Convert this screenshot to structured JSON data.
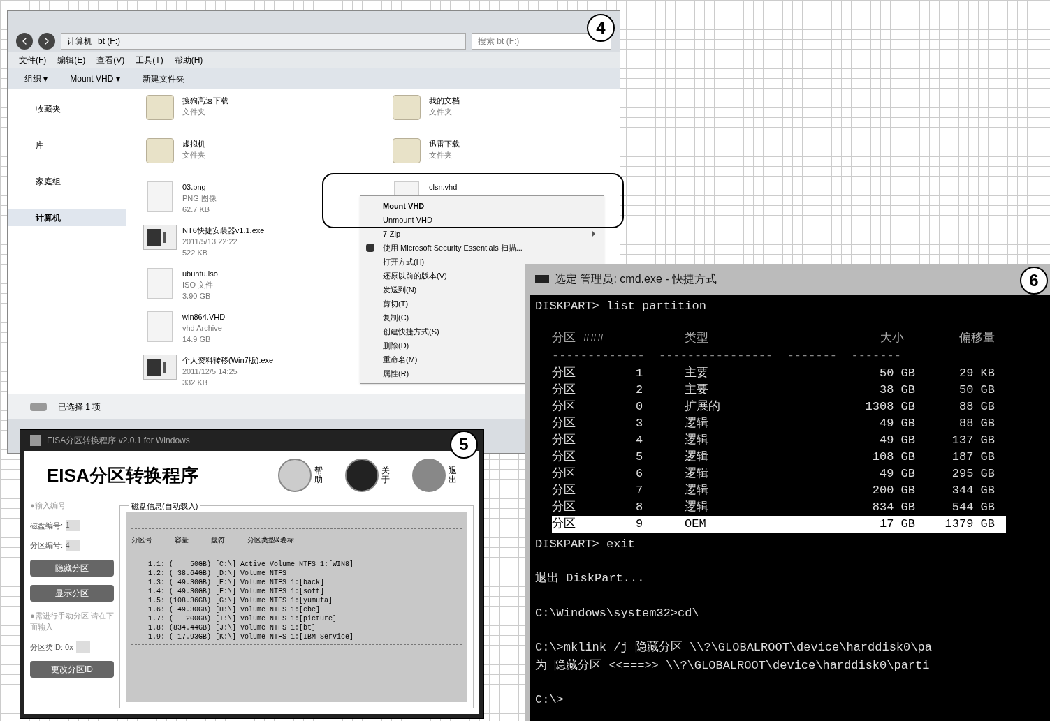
{
  "callouts": [
    "4",
    "5",
    "6"
  ],
  "explorer": {
    "address": [
      "计算机",
      "bt (F:)"
    ],
    "search": {
      "placeholder": "搜索 bt (F:)"
    },
    "menu": [
      "文件(F)",
      "编辑(E)",
      "查看(V)",
      "工具(T)",
      "帮助(H)"
    ],
    "toolbar": [
      "组织 ▾",
      "Mount VHD ▾",
      "新建文件夹"
    ],
    "sidebar": [
      {
        "label": "收藏夹",
        "selected": false
      },
      {
        "label": "库",
        "selected": false
      },
      {
        "label": "家庭组",
        "selected": false
      },
      {
        "label": "计算机",
        "selected": true
      }
    ],
    "files": [
      {
        "kind": "folder",
        "name": "搜狗高速下载",
        "lines": [
          "文件夹"
        ]
      },
      {
        "kind": "folder",
        "name": "我的文档",
        "lines": [
          "文件夹"
        ]
      },
      {
        "kind": "folder",
        "name": "虚拟机",
        "lines": [
          "文件夹"
        ]
      },
      {
        "kind": "folder",
        "name": "迅雷下载",
        "lines": [
          "文件夹"
        ]
      },
      {
        "kind": "doc",
        "name": "03.png",
        "lines": [
          "PNG 图像",
          "62.7 KB"
        ]
      },
      {
        "kind": "doc",
        "name": "clsn.vhd"
      },
      {
        "kind": "exe",
        "name": "NT6快捷安装器v1.1.exe",
        "lines": [
          "2011/5/13 22:22",
          "522 KB"
        ]
      },
      {
        "kind": "none"
      },
      {
        "kind": "doc",
        "name": "ubuntu.iso",
        "lines": [
          "ISO 文件",
          "3.90 GB"
        ]
      },
      {
        "kind": "none"
      },
      {
        "kind": "doc",
        "name": "win864.VHD",
        "lines": [
          "vhd Archive",
          "14.9 GB"
        ]
      },
      {
        "kind": "none"
      },
      {
        "kind": "exe",
        "name": "个人资料转移(Win7版).exe",
        "lines": [
          "2011/12/5 14:25",
          "332 KB"
        ]
      }
    ],
    "status": "已选择 1 项",
    "context_menu": [
      {
        "label": "Mount VHD",
        "bold": true
      },
      {
        "label": "Unmount VHD",
        "bold": false
      },
      {
        "label": "7-Zip",
        "bold": false,
        "submenu": true
      },
      {
        "label": "使用 Microsoft Security Essentials 扫描...",
        "bold": false,
        "icon": true
      },
      {
        "label": "打开方式(H)",
        "bold": false
      },
      {
        "label": "还原以前的版本(V)",
        "bold": false
      },
      {
        "label": "发送到(N)",
        "bold": false
      },
      {
        "label": "剪切(T)",
        "bold": false
      },
      {
        "label": "复制(C)",
        "bold": false
      },
      {
        "label": "创建快捷方式(S)",
        "bold": false
      },
      {
        "label": "删除(D)",
        "bold": false
      },
      {
        "label": "重命名(M)",
        "bold": false
      },
      {
        "label": "属性(R)",
        "bold": false
      }
    ]
  },
  "eisa": {
    "title": "EISA分区转换程序 v2.0.1 for Windows",
    "heading": "EISA分区转换程序",
    "actions": [
      {
        "label": "帮助",
        "kind": "help"
      },
      {
        "label": "关于",
        "kind": "about"
      },
      {
        "label": "退出",
        "kind": "exit"
      }
    ],
    "left": [
      {
        "kind": "note",
        "text": "●输入编号"
      },
      {
        "kind": "field",
        "label": "磁盘编号:",
        "value": "1"
      },
      {
        "kind": "field",
        "label": "分区编号:",
        "value": "4"
      },
      {
        "kind": "button",
        "text": "隐藏分区"
      },
      {
        "kind": "button",
        "text": "显示分区"
      },
      {
        "kind": "note",
        "text": "●需进行手动分区 请在下面输入"
      },
      {
        "kind": "field",
        "label": "分区类ID: 0x"
      },
      {
        "kind": "button",
        "text": "更改分区ID"
      }
    ],
    "group": "磁盘信息(自动载入)",
    "listing_header": [
      "分区号",
      "容量",
      "盘符",
      "分区类型&卷标"
    ],
    "listing": [
      "1.1: (    50GB) [C:\\] Active Volume NTFS 1:[WIN8]",
      "1.2: ( 38.64GB) [D:\\] Volume NTFS",
      "1.3: ( 49.30GB) [E:\\] Volume NTFS 1:[back]",
      "1.4: ( 49.30GB) [F:\\] Volume NTFS 1:[soft]",
      "1.5: (108.36GB) [G:\\] Volume NTFS 1:[yumufa]",
      "1.6: ( 49.30GB) [H:\\] Volume NTFS 1:[cbe]",
      "1.7: (   200GB) [I:\\] Volume NTFS 1:[picture]",
      "1.8: (834.44GB) [J:\\] Volume NTFS 1:[bt]",
      "1.9: ( 17.93GB) [K:\\] Volume NTFS 1:[IBM_Service]"
    ]
  },
  "cmd": {
    "title": "选定 管理员: cmd.exe - 快捷方式",
    "command1": "DISKPART> list partition",
    "columns": [
      "分区 ###",
      "类型",
      "大小",
      "偏移量"
    ],
    "separator": "-------------  ----------------  -------  -------",
    "rows": [
      {
        "name": "分区",
        "num": "1",
        "type": "主要",
        "size": "50 GB",
        "offset": "29 KB",
        "selected": false
      },
      {
        "name": "分区",
        "num": "2",
        "type": "主要",
        "size": "38 GB",
        "offset": "50 GB",
        "selected": false
      },
      {
        "name": "分区",
        "num": "0",
        "type": "扩展的",
        "size": "1308 GB",
        "offset": "88 GB",
        "selected": false
      },
      {
        "name": "分区",
        "num": "3",
        "type": "逻辑",
        "size": "49 GB",
        "offset": "88 GB",
        "selected": false
      },
      {
        "name": "分区",
        "num": "4",
        "type": "逻辑",
        "size": "49 GB",
        "offset": "137 GB",
        "selected": false
      },
      {
        "name": "分区",
        "num": "5",
        "type": "逻辑",
        "size": "108 GB",
        "offset": "187 GB",
        "selected": false
      },
      {
        "name": "分区",
        "num": "6",
        "type": "逻辑",
        "size": "49 GB",
        "offset": "295 GB",
        "selected": false
      },
      {
        "name": "分区",
        "num": "7",
        "type": "逻辑",
        "size": "200 GB",
        "offset": "344 GB",
        "selected": false
      },
      {
        "name": "分区",
        "num": "8",
        "type": "逻辑",
        "size": "834 GB",
        "offset": "544 GB",
        "selected": false
      },
      {
        "name": "分区",
        "num": "9",
        "type": "OEM",
        "size": "17 GB",
        "offset": "1379 GB",
        "selected": true
      }
    ],
    "after": [
      [
        "DISKPART> exit"
      ],
      [
        "退出 DiskPart..."
      ],
      [
        "C:\\Windows\\system32>cd\\"
      ],
      [
        "C:\\>mklink /j 隐藏分区 \\\\?\\GLOBALROOT\\device\\harddisk0\\pa",
        "为 隐藏分区 <<===>> \\\\?\\GLOBALROOT\\device\\harddisk0\\parti"
      ],
      [
        "C:\\>"
      ]
    ]
  }
}
